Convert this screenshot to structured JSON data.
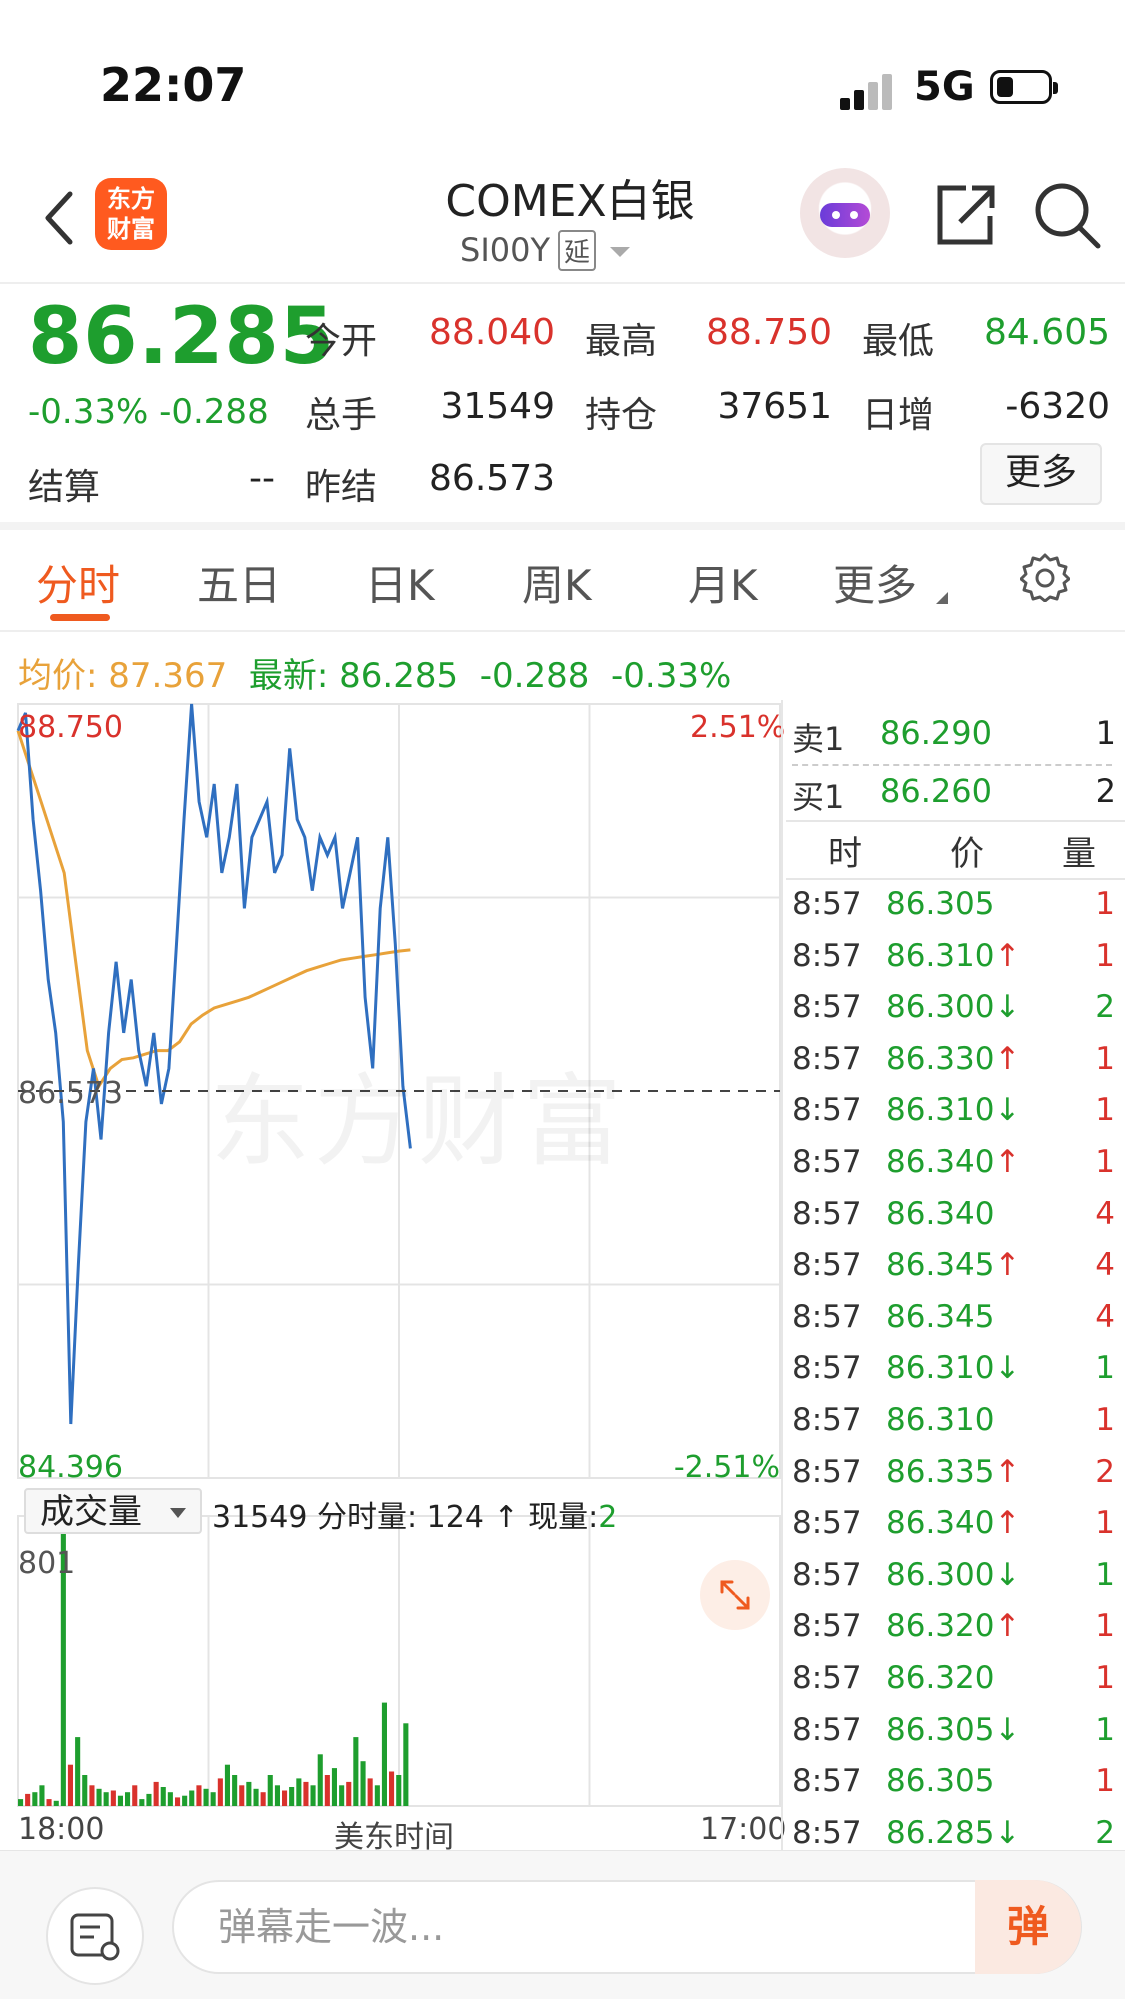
{
  "status_bar": {
    "time": "22:07",
    "network": "5G"
  },
  "header": {
    "app_logo_text": "东方财富",
    "title": "COMEX白银",
    "symbol": "SI00Y",
    "delay_tag": "延"
  },
  "quote": {
    "last_price": "86.285",
    "change_pct": "-0.33%",
    "change": "-0.288",
    "fields": {
      "open": {
        "label": "今开",
        "value": "88.040"
      },
      "high": {
        "label": "最高",
        "value": "88.750"
      },
      "low": {
        "label": "最低",
        "value": "84.605"
      },
      "volume": {
        "label": "总手",
        "value": "31549"
      },
      "open_interest": {
        "label": "持仓",
        "value": "37651"
      },
      "daily_increase": {
        "label": "日增",
        "value": "-6320"
      },
      "settle": {
        "label": "结算",
        "value": "--"
      },
      "prev_settle": {
        "label": "昨结",
        "value": "86.573"
      }
    },
    "more_label": "更多"
  },
  "tabs": [
    "分时",
    "五日",
    "日K",
    "周K",
    "月K",
    "更多"
  ],
  "active_tab": "分时",
  "summary_line": {
    "avg_label": "均价:",
    "avg_value": "87.367",
    "latest_label": "最新:",
    "latest_value": "86.285",
    "change": "-0.288",
    "change_pct": "-0.33%"
  },
  "chart_axis": {
    "top_price": "88.750",
    "mid_price": "86.573",
    "bottom_price": "84.396",
    "top_pct": "2.51%",
    "bottom_pct": "-2.51%",
    "x_start": "18:00",
    "x_mid": "美东时间",
    "x_end": "17:00",
    "watermark": "东方财富"
  },
  "volume_panel": {
    "selector_label": "成交量",
    "total_volume": "31549",
    "tick_volume_label": "分时量:",
    "tick_volume": "124",
    "tick_arrow": "↑",
    "current_label": "现量:",
    "current_volume": "2",
    "max_label": "801"
  },
  "order_book": {
    "ask": {
      "label": "卖1",
      "price": "86.290",
      "qty": "1"
    },
    "bid": {
      "label": "买1",
      "price": "86.260",
      "qty": "2"
    }
  },
  "ticks_header": {
    "time": "时",
    "price": "价",
    "qty": "量"
  },
  "ticks": [
    {
      "time": "8:57",
      "price": "86.305",
      "arrow": "",
      "qty": "1",
      "qty_color": "red"
    },
    {
      "time": "8:57",
      "price": "86.310",
      "arrow": "↑",
      "qty": "1",
      "qty_color": "red"
    },
    {
      "time": "8:57",
      "price": "86.300",
      "arrow": "↓",
      "qty": "2",
      "qty_color": "green"
    },
    {
      "time": "8:57",
      "price": "86.330",
      "arrow": "↑",
      "qty": "1",
      "qty_color": "red"
    },
    {
      "time": "8:57",
      "price": "86.310",
      "arrow": "↓",
      "qty": "1",
      "qty_color": "red"
    },
    {
      "time": "8:57",
      "price": "86.340",
      "arrow": "↑",
      "qty": "1",
      "qty_color": "red"
    },
    {
      "time": "8:57",
      "price": "86.340",
      "arrow": "",
      "qty": "4",
      "qty_color": "red"
    },
    {
      "time": "8:57",
      "price": "86.345",
      "arrow": "↑",
      "qty": "4",
      "qty_color": "red"
    },
    {
      "time": "8:57",
      "price": "86.345",
      "arrow": "",
      "qty": "4",
      "qty_color": "red"
    },
    {
      "time": "8:57",
      "price": "86.310",
      "arrow": "↓",
      "qty": "1",
      "qty_color": "green"
    },
    {
      "time": "8:57",
      "price": "86.310",
      "arrow": "",
      "qty": "1",
      "qty_color": "red"
    },
    {
      "time": "8:57",
      "price": "86.335",
      "arrow": "↑",
      "qty": "2",
      "qty_color": "red"
    },
    {
      "time": "8:57",
      "price": "86.340",
      "arrow": "↑",
      "qty": "1",
      "qty_color": "red"
    },
    {
      "time": "8:57",
      "price": "86.300",
      "arrow": "↓",
      "qty": "1",
      "qty_color": "green"
    },
    {
      "time": "8:57",
      "price": "86.320",
      "arrow": "↑",
      "qty": "1",
      "qty_color": "red"
    },
    {
      "time": "8:57",
      "price": "86.320",
      "arrow": "",
      "qty": "1",
      "qty_color": "red"
    },
    {
      "time": "8:57",
      "price": "86.305",
      "arrow": "↓",
      "qty": "1",
      "qty_color": "green"
    },
    {
      "time": "8:57",
      "price": "86.305",
      "arrow": "",
      "qty": "1",
      "qty_color": "red"
    },
    {
      "time": "8:57",
      "price": "86.285",
      "arrow": "↓",
      "qty": "2",
      "qty_color": "green"
    }
  ],
  "bottom_bar": {
    "input_placeholder": "弹幕走一波...",
    "send_label": "弹"
  },
  "colors": {
    "up": "#d9322c",
    "down": "#1e9e2e",
    "accent": "#ef5a1f",
    "avg_line": "#e8a23a",
    "price_line": "#2f6fc0"
  },
  "chart_data": {
    "type": "line",
    "series": [
      {
        "name": "最新",
        "values": [
          88.6,
          88.7,
          88.1,
          87.7,
          87.2,
          86.9,
          86.4,
          84.7,
          85.6,
          86.4,
          86.7,
          86.3,
          86.9,
          87.3,
          86.9,
          87.2,
          86.8,
          86.6,
          86.9,
          86.5,
          86.7,
          87.4,
          88.1,
          88.75,
          88.2,
          88.0,
          88.3,
          87.8,
          88.0,
          88.3,
          87.6,
          88.0,
          88.1,
          88.2,
          87.8,
          87.9,
          88.5,
          88.1,
          88.0,
          87.7,
          88.0,
          87.9,
          88.0,
          87.6,
          87.8,
          88.0,
          87.1,
          86.7,
          87.6,
          88.0,
          87.4,
          86.6,
          86.25
        ]
      },
      {
        "name": "均价",
        "values": [
          88.6,
          88.4,
          88.2,
          88.0,
          87.8,
          87.3,
          86.8,
          86.6,
          86.7,
          86.75,
          86.76,
          86.78,
          86.8,
          86.8,
          86.85,
          86.95,
          87.0,
          87.04,
          87.06,
          87.08,
          87.1,
          87.13,
          87.16,
          87.19,
          87.22,
          87.25,
          87.27,
          87.29,
          87.31,
          87.32,
          87.33,
          87.34,
          87.35,
          87.36,
          87.367
        ]
      }
    ],
    "ylim": [
      84.396,
      88.75
    ],
    "reference": 86.573,
    "volume": [
      20,
      35,
      40,
      60,
      20,
      15,
      801,
      120,
      200,
      90,
      60,
      50,
      40,
      45,
      30,
      40,
      60,
      20,
      35,
      70,
      55,
      40,
      25,
      30,
      45,
      60,
      50,
      40,
      80,
      120,
      90,
      60,
      70,
      50,
      40,
      90,
      60,
      45,
      55,
      80,
      70,
      60,
      150,
      90,
      110,
      60,
      70,
      200,
      130,
      80,
      60,
      300,
      100,
      90,
      240
    ]
  }
}
